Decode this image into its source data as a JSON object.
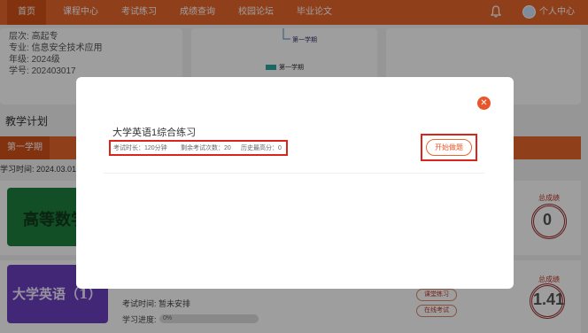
{
  "nav": {
    "items": [
      "首页",
      "课程中心",
      "考试练习",
      "成绩查询",
      "校园论坛",
      "毕业论文"
    ],
    "user_label": "个人中心",
    "accent": "#e9662c"
  },
  "profile": {
    "lines": [
      {
        "key": "层次:",
        "value": "高起专"
      },
      {
        "key": "专业:",
        "value": "信息安全技术应用"
      },
      {
        "key": "年级:",
        "value": "2024级"
      },
      {
        "key": "学号:",
        "value": "202403017"
      }
    ]
  },
  "term_chart": {
    "node_label": "第一学期",
    "legend_label": "第一学期"
  },
  "plan": {
    "title": "教学计划",
    "term_tab": "第一学期",
    "study_time": "学习时间: 2024.03.01 ~"
  },
  "courses": [
    {
      "thumb_label": "高等数学",
      "score_label": "总成绩",
      "score": "0"
    },
    {
      "thumb_label": "大学英语（1）",
      "score_label": "总成绩",
      "score": "1.41",
      "exam_time": "考试时间: 暂未安排",
      "progress_label": "学习进度:",
      "progress_value": "0%",
      "progress_fraction": 0,
      "btn_practice": "课堂练习",
      "btn_online": "在线考试"
    }
  ],
  "modal": {
    "title": "大学英语1综合练习",
    "duration": "考试时长：120分钟",
    "remaining": "剩余考试次数：20",
    "best": "历史最高分：0",
    "start_label": "开始做题",
    "close_icon": "close-icon"
  }
}
